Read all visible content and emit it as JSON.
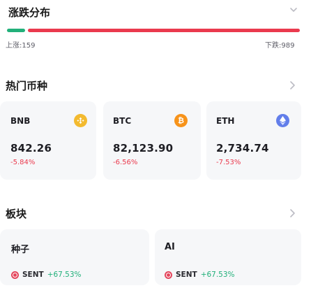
{
  "distribution": {
    "title": "涨跌分布",
    "up_label": "上涨:159",
    "down_label": "下跌:989",
    "up_count": 159,
    "down_count": 989,
    "up_color": "#22b07a",
    "down_color": "#ea3a4e"
  },
  "hot": {
    "title": "热门币种",
    "coins": [
      {
        "symbol": "BNB",
        "price": "842.26",
        "change": "-5.84%",
        "icon": "bnb-icon",
        "color": "#f3ba2f"
      },
      {
        "symbol": "BTC",
        "price": "82,123.90",
        "change": "-6.56%",
        "icon": "btc-icon",
        "color": "#f7931a"
      },
      {
        "symbol": "ETH",
        "price": "2,734.74",
        "change": "-7.53%",
        "icon": "eth-icon",
        "color": "#627eea"
      }
    ]
  },
  "sectors": {
    "title": "板块",
    "items": [
      {
        "name": "种子",
        "token": "SENT",
        "change": "+67.53%"
      },
      {
        "name": "AI",
        "token": "SENT",
        "change": "+67.53%"
      }
    ]
  },
  "colors": {
    "negative": "#ea3a4e",
    "positive": "#22b07a"
  }
}
